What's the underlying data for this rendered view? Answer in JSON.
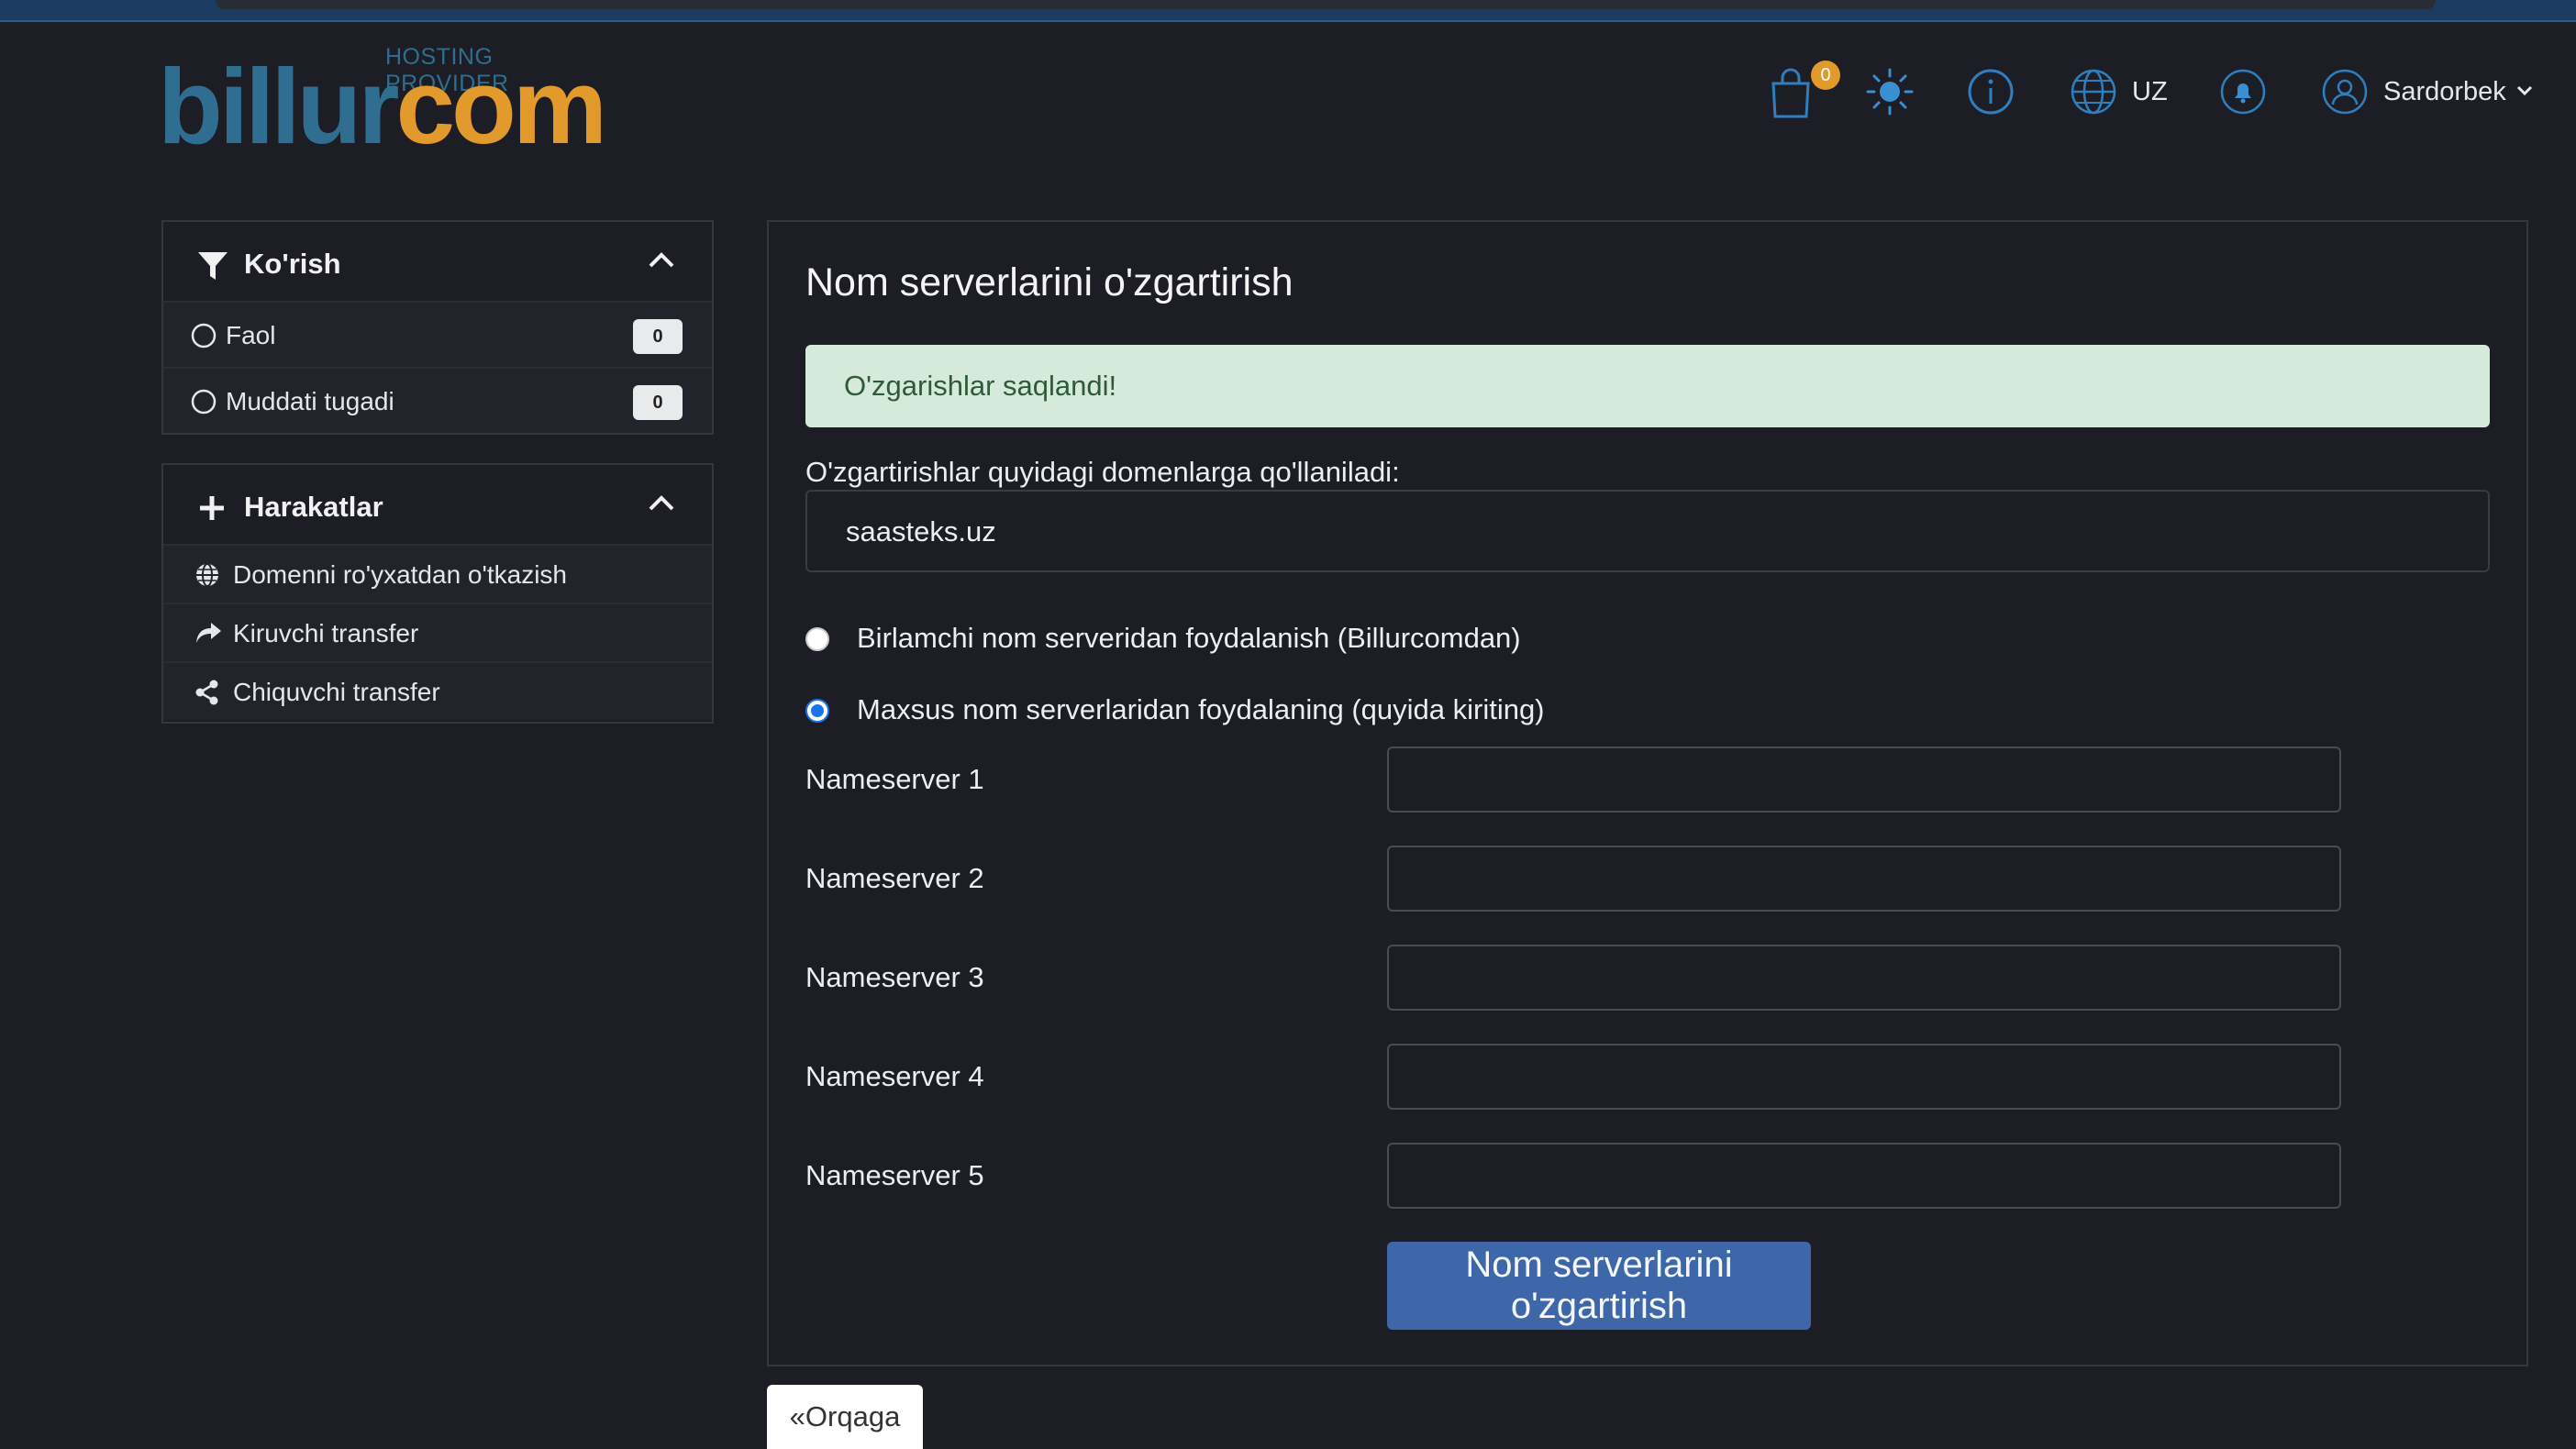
{
  "logo": {
    "tagline": "HOSTING PROVIDER",
    "word_part1": "billur",
    "word_part2": "com"
  },
  "header": {
    "cart_count": "0",
    "language": "UZ",
    "username": "Sardorbek",
    "icons": [
      "shopping-bag-icon",
      "sun-icon",
      "info-icon",
      "globe-icon",
      "bell-icon",
      "user-icon"
    ]
  },
  "sidebar": {
    "view": {
      "title": "Ko'rish",
      "items": [
        {
          "label": "Faol",
          "count": "0"
        },
        {
          "label": "Muddati tugadi",
          "count": "0"
        }
      ]
    },
    "actions": {
      "title": "Harakatlar",
      "items": [
        {
          "label": "Domenni ro'yxatdan o'tkazish",
          "icon": "globe-icon"
        },
        {
          "label": "Kiruvchi transfer",
          "icon": "share-arrow-icon"
        },
        {
          "label": "Chiquvchi transfer",
          "icon": "share-nodes-icon"
        }
      ]
    }
  },
  "main": {
    "title": "Nom serverlarini o'zgartirish",
    "alert": "O'zgarishlar saqlandi!",
    "domains_label": "O'zgartirishlar quyidagi domenlarga qo'llaniladi:",
    "domain": "saasteks.uz",
    "radio_default": "Birlamchi nom serveridan foydalanish (Billurcomdan)",
    "radio_custom": "Maxsus nom serverlaridan foydalaning (quyida kiriting)",
    "selected_option": "custom",
    "nameservers": [
      {
        "label": "Nameserver 1",
        "value": ""
      },
      {
        "label": "Nameserver 2",
        "value": ""
      },
      {
        "label": "Nameserver 3",
        "value": ""
      },
      {
        "label": "Nameserver 4",
        "value": ""
      },
      {
        "label": "Nameserver 5",
        "value": ""
      }
    ],
    "submit_label": "Nom serverlarini o'zgartirish",
    "back_label": "«Orqaga"
  },
  "colors": {
    "background": "#1c1d25",
    "brand_blue": "#2f6d91",
    "brand_orange": "#e39a2c",
    "primary_button": "#3d67a8",
    "success_alert_bg": "#d6eadb",
    "success_alert_text": "#2f5a39"
  }
}
